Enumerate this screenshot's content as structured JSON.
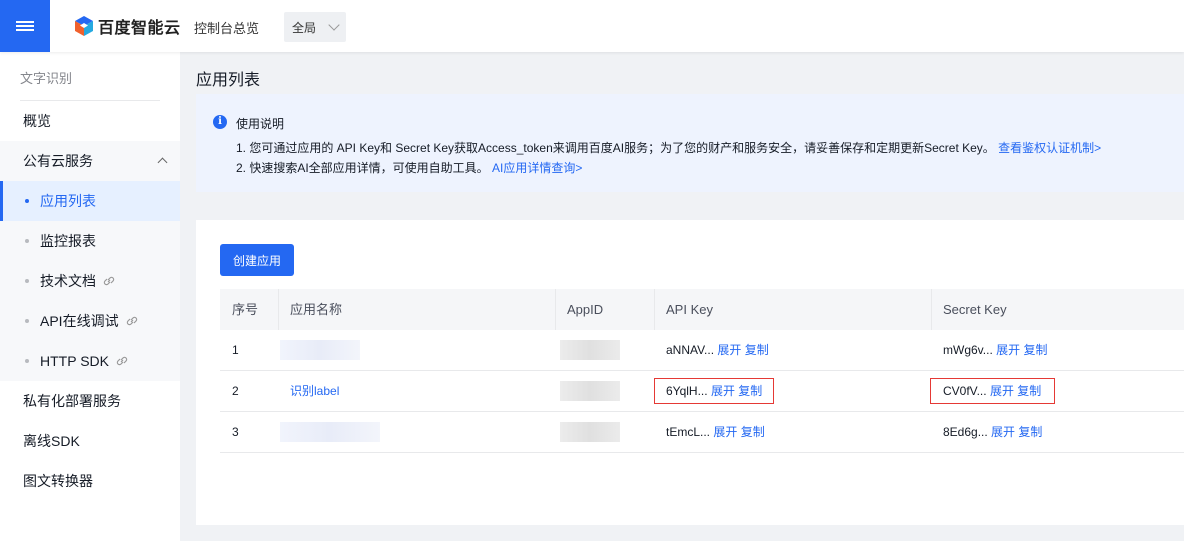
{
  "topbar": {
    "logo_text": "百度智能云",
    "console": "控制台总览",
    "region": "全局"
  },
  "sidebar": {
    "title": "文字识别",
    "items": [
      {
        "label": "概览"
      },
      {
        "label": "公有云服务"
      },
      {
        "label": "应用列表"
      },
      {
        "label": "监控报表"
      },
      {
        "label": "技术文档"
      },
      {
        "label": "API在线调试"
      },
      {
        "label": "HTTP SDK"
      },
      {
        "label": "私有化部署服务"
      },
      {
        "label": "离线SDK"
      },
      {
        "label": "图文转换器"
      }
    ]
  },
  "main": {
    "page_title": "应用列表",
    "notice": {
      "head": "使用说明",
      "line1": "1. 您可通过应用的 API Key和 Secret Key获取Access_token来调用百度AI服务；为了您的财产和服务安全，请妥善保存和定期更新Secret Key。",
      "line1_link": "查看鉴权认证机制>",
      "line2": "2. 快速搜索AI全部应用详情，可使用自助工具。",
      "line2_link": "AI应用详情查询>"
    },
    "create_button": "创建应用",
    "table": {
      "headers": [
        "序号",
        "应用名称",
        "AppID",
        "API Key",
        "Secret Key"
      ],
      "expand_label": "展开",
      "copy_label": "复制",
      "rows": [
        {
          "index": "1",
          "name": "",
          "api_key": "aNNAV...",
          "secret_key": "mWg6v..."
        },
        {
          "index": "2",
          "name": "识别label",
          "api_key": "6YqlH...",
          "secret_key": "CV0fV..."
        },
        {
          "index": "3",
          "name": "",
          "api_key": "tEmcL...",
          "secret_key": "8Ed6g..."
        }
      ]
    }
  },
  "colors": {
    "accent": "#2468f2",
    "highlight_border": "#e53935",
    "notice_bg": "#eef3fe"
  }
}
